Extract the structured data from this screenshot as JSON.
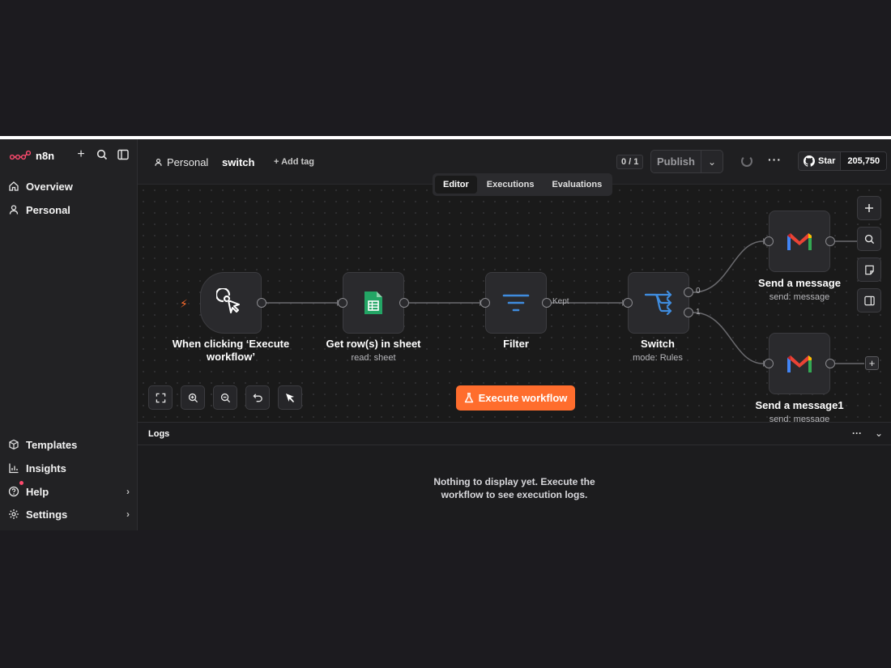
{
  "brand": {
    "name": "n8n"
  },
  "sidebar": {
    "top_items": [
      {
        "label": "Overview",
        "icon": "home-icon"
      },
      {
        "label": "Personal",
        "icon": "user-icon"
      }
    ],
    "bottom_items": [
      {
        "label": "Templates",
        "icon": "box-icon"
      },
      {
        "label": "Insights",
        "icon": "chart-icon"
      },
      {
        "label": "Help",
        "icon": "help-icon"
      },
      {
        "label": "Settings",
        "icon": "gear-icon"
      }
    ]
  },
  "header": {
    "project": "Personal",
    "workflow_name": "switch",
    "add_tag": "+ Add tag",
    "version": "0 / 1",
    "publish_label": "Publish",
    "github_star": "Star",
    "github_count": "205,750"
  },
  "tabs": [
    {
      "label": "Editor",
      "active": true
    },
    {
      "label": "Executions",
      "active": false
    },
    {
      "label": "Evaluations",
      "active": false
    }
  ],
  "nodes": {
    "trigger": {
      "label": "When clicking ‘Execute workflow’",
      "sub": ""
    },
    "sheets": {
      "label": "Get row(s) in sheet",
      "sub": "read: sheet"
    },
    "filter": {
      "label": "Filter",
      "sub": ""
    },
    "switch": {
      "label": "Switch",
      "sub": "mode: Rules"
    },
    "gmail1": {
      "label": "Send a message",
      "sub": "send: message"
    },
    "gmail2": {
      "label": "Send a message1",
      "sub": "send: message"
    }
  },
  "edges": {
    "kept_label": "Kept",
    "out0": "0",
    "out1": "1"
  },
  "execute_button": "Execute workflow",
  "logs": {
    "title": "Logs",
    "empty_line1": "Nothing to display yet. Execute the",
    "empty_line2": "workflow to see execution logs."
  },
  "colors": {
    "accent": "#ff6d2d",
    "sheets_green": "#23a565",
    "filter_blue": "#3f8cde"
  }
}
